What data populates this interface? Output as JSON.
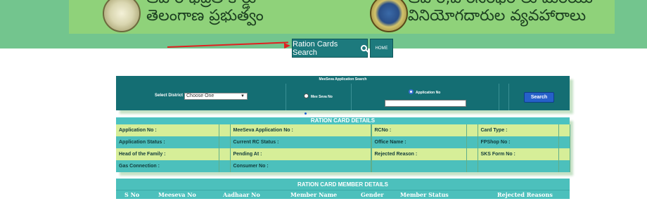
{
  "banner": {
    "left_line1": "ఆహార భద్రత కార్డు",
    "left_line2": "తెలంగాణ ప్రభుత్వం",
    "right_line1": "ఆహార,పౌరసరఫరాలు మరియు",
    "right_line2": "వినియోగదారుల వ్యవహారాలు"
  },
  "nav": {
    "ration_cards_search": "Ration Cards Search",
    "home": "HOME"
  },
  "search_panel": {
    "title": "MeeSeva Application Search",
    "select_district_label": "Select District :",
    "district_selected": "Choose One",
    "option_meeseva_no": "Mee Seva No",
    "option_application_no": "Application No",
    "selected_option": "Application No",
    "application_no_value": "",
    "search_button": "Search"
  },
  "ration_card_details": {
    "title": "RATION CARD DETAILS",
    "rows": [
      [
        "Application No :",
        "",
        "MeeSeva Application No :",
        "",
        "RCNo :",
        "",
        "Card Type :",
        ""
      ],
      [
        "Application Status :",
        "",
        "Current RC Status :",
        "",
        "Office Name :",
        "",
        "FPShop No :",
        ""
      ],
      [
        "Head of the Family :",
        "",
        "Pending At :",
        "",
        "Rejected Reason :",
        "",
        "SKS Form No :",
        ""
      ],
      [
        "Gas Connection :",
        "",
        "Consumer No :",
        "",
        "",
        "",
        "",
        ""
      ]
    ]
  },
  "member_details": {
    "title": "RATION CARD MEMBER DETAILS",
    "columns": [
      "S No",
      "Meeseva No",
      "Aadhaar No",
      "Member Name",
      "Gender",
      "Member Status",
      "Rejected Reasons"
    ]
  },
  "colors": {
    "header_band": "#73c58e",
    "banner": "#8fd27a",
    "panel_teal": "#146e73",
    "section_teal": "#4bc2c1",
    "row_green": "#d6ee98",
    "search_blue": "#2660c9",
    "arrow_red": "#e02020"
  }
}
